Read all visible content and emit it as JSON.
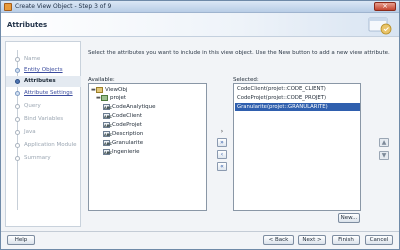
{
  "window": {
    "title": "Create View Object - Step 3 of 9",
    "close_label": "×"
  },
  "header": {
    "title": "Attributes"
  },
  "nav": {
    "items": [
      {
        "label": "Name",
        "state": "disabled"
      },
      {
        "label": "Entity Objects",
        "state": "link"
      },
      {
        "label": "Attributes",
        "state": "current"
      },
      {
        "label": "Attribute Settings",
        "state": "link"
      },
      {
        "label": "Query",
        "state": "disabled"
      },
      {
        "label": "Bind Variables",
        "state": "disabled"
      },
      {
        "label": "Java",
        "state": "disabled"
      },
      {
        "label": "Application Module",
        "state": "disabled"
      },
      {
        "label": "Summary",
        "state": "disabled"
      }
    ]
  },
  "main": {
    "instruction": "Select the attributes you want to include in this view object.  Use the New button to add a new view attribute.",
    "available_label": "Available:",
    "selected_label": "Selected:",
    "available_tree": {
      "root": "ViewObj",
      "entity": "projet",
      "attributes": [
        "CodeAnalytique",
        "CodeClient",
        "CodeProjet",
        "Description",
        "Granularite",
        "Ingenierie"
      ],
      "attr_icon_text": "ABC"
    },
    "selected_items": [
      {
        "text": "CodeClient(projet::CODE_CLIENT)",
        "selected": false
      },
      {
        "text": "CodeProjet(projet::CODE_PROJET)",
        "selected": false
      },
      {
        "text": "Granularite(projet::GRANULARITE)",
        "selected": true
      }
    ],
    "shuttle": {
      "move_right": "›",
      "move_all_right": "»",
      "move_left": "‹",
      "move_all_left": "«"
    },
    "reorder": {
      "up": "▲",
      "down": "▼"
    },
    "new_button": "New..."
  },
  "footer": {
    "help": "Help",
    "back": "< Back",
    "next": "Next >",
    "finish": "Finish",
    "cancel": "Cancel"
  }
}
